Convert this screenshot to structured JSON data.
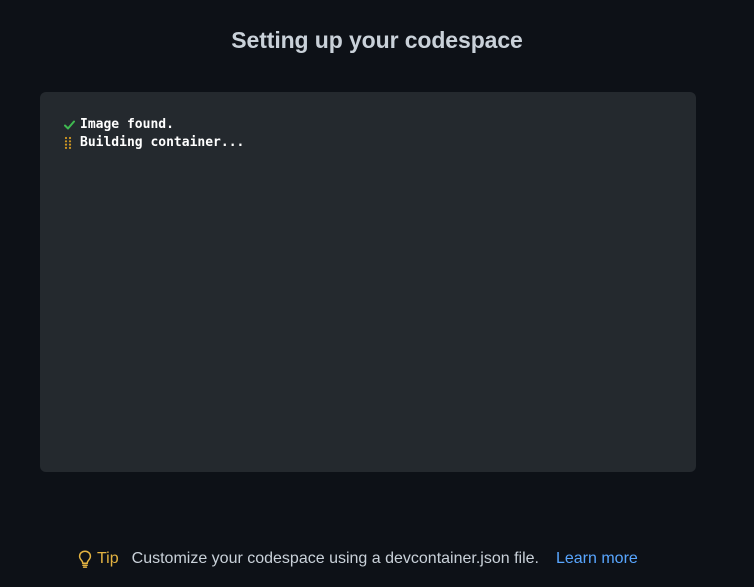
{
  "page": {
    "title": "Setting up your codespace"
  },
  "log": {
    "lines": [
      {
        "status": "done",
        "icon": "check-icon",
        "text": "Image found."
      },
      {
        "status": "in-progress",
        "icon": "spinner-icon",
        "text": "Building container..."
      }
    ]
  },
  "tip": {
    "icon": "light-bulb-icon",
    "label": "Tip",
    "text": "Customize your codespace using a devcontainer.json file.",
    "link_label": "Learn more"
  },
  "colors": {
    "background": "#0d1117",
    "panel": "#24292e",
    "success": "#3fb950",
    "pending": "#d29922",
    "tip_label": "#e3b341",
    "link": "#58a6ff"
  }
}
